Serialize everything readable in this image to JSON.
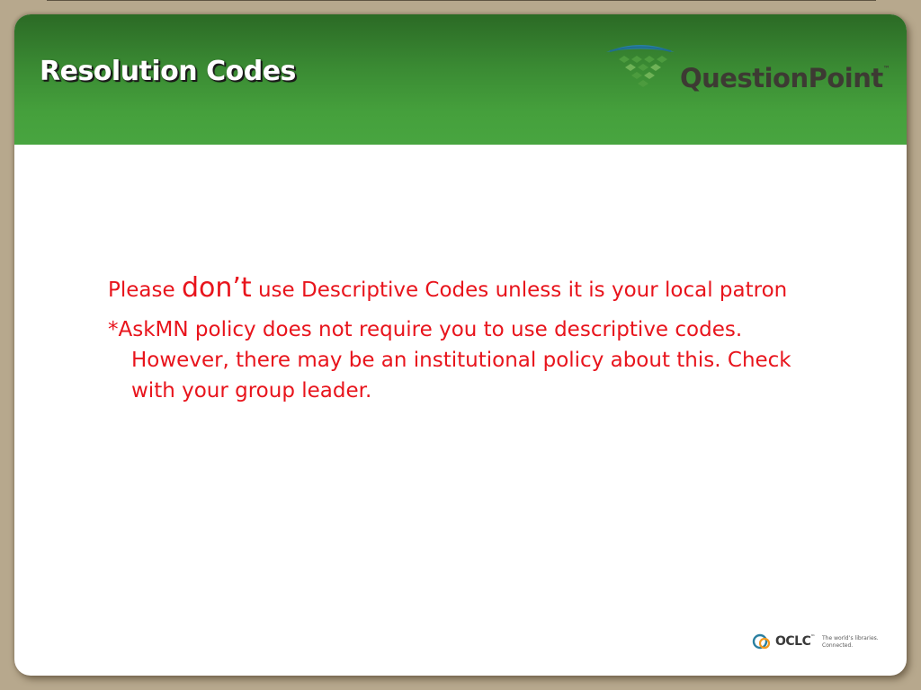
{
  "slide": {
    "title": "Resolution Codes"
  },
  "logo": {
    "name": "QuestionPoint",
    "trademark": "™"
  },
  "body": {
    "p1_before": "Please ",
    "p1_emphasis": "don’t",
    "p1_after": " use Descriptive Codes unless it is your local patron",
    "p2": "*AskMN policy does not require you to use descriptive codes. However, there may be an institutional policy about this. Check with your group leader."
  },
  "footer_logo": {
    "name": "OCLC",
    "trademark": "™",
    "tagline_line1": "The world’s libraries.",
    "tagline_line2": "Connected."
  },
  "colors": {
    "header_green": "#45a03c",
    "body_text_red": "#e8141c",
    "frame_tan": "#b7a88d",
    "logo_teal": "#2a7fa0",
    "logo_green": "#4c9b3e"
  }
}
